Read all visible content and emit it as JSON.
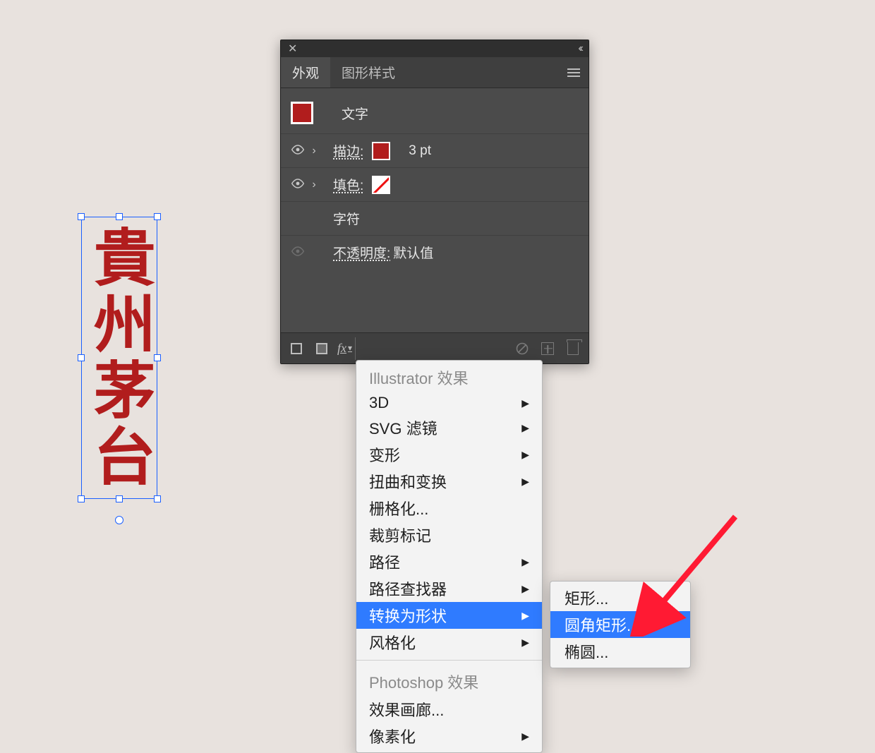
{
  "canvas": {
    "text": "貴州茅台"
  },
  "panel": {
    "tabs": {
      "appearance": "外观",
      "graphic_styles": "图形样式"
    },
    "rows": {
      "type_label": "文字",
      "stroke_label": "描边:",
      "stroke_value": "3 pt",
      "fill_label": "填色:",
      "characters_label": "字符",
      "opacity_label": "不透明度:",
      "opacity_value": "默认值"
    },
    "footer": {
      "fx_label": "fx"
    }
  },
  "effects_menu": {
    "section1_title": "Illustrator 效果",
    "items1": [
      {
        "label": "3D",
        "submenu": true
      },
      {
        "label": "SVG 滤镜",
        "submenu": true
      },
      {
        "label": "变形",
        "submenu": true
      },
      {
        "label": "扭曲和变换",
        "submenu": true
      },
      {
        "label": "栅格化...",
        "submenu": false
      },
      {
        "label": "裁剪标记",
        "submenu": false
      },
      {
        "label": "路径",
        "submenu": true
      },
      {
        "label": "路径查找器",
        "submenu": true
      },
      {
        "label": "转换为形状",
        "submenu": true,
        "highlight": true
      },
      {
        "label": "风格化",
        "submenu": true
      }
    ],
    "section2_title": "Photoshop 效果",
    "items2": [
      {
        "label": "效果画廊...",
        "submenu": false
      },
      {
        "label": "像素化",
        "submenu": true
      }
    ]
  },
  "convert_submenu": {
    "items": [
      {
        "label": "矩形...",
        "highlight": false
      },
      {
        "label": "圆角矩形...",
        "highlight": true
      },
      {
        "label": "椭圆...",
        "highlight": false
      }
    ]
  }
}
